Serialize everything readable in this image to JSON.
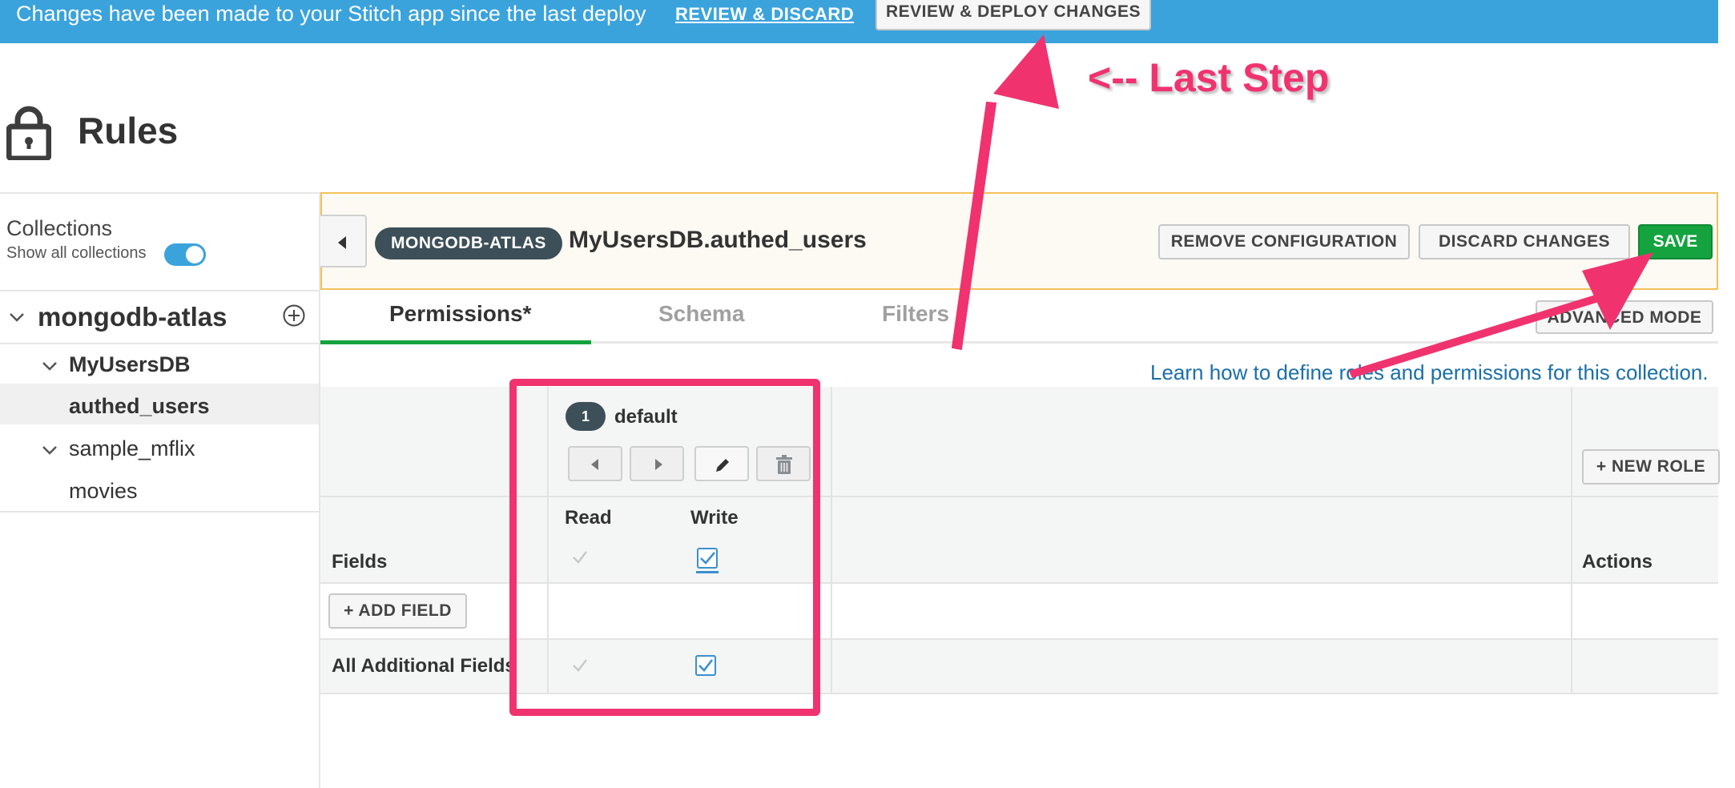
{
  "banner": {
    "message": "Changes have been made to your Stitch app since the last deploy",
    "review_discard_link": "REVIEW & DISCARD",
    "deploy_button": "REVIEW & DEPLOY CHANGES"
  },
  "header": {
    "title": "Rules",
    "icon": "lock-icon"
  },
  "sidebar": {
    "collections_label": "Collections",
    "show_all_label": "Show all collections",
    "show_all_enabled": true,
    "service": {
      "name": "mongodb-atlas",
      "databases": [
        {
          "name": "MyUsersDB",
          "collections": [
            "authed_users"
          ]
        },
        {
          "name": "sample_mflix",
          "collections": [
            "movies"
          ]
        }
      ]
    },
    "selected_collection": "authed_users"
  },
  "collection_header": {
    "service_badge": "MONGODB-ATLAS",
    "namespace": "MyUsersDB.authed_users",
    "remove_button": "REMOVE CONFIGURATION",
    "discard_button": "DISCARD CHANGES",
    "save_button": "SAVE"
  },
  "tabs": [
    {
      "label": "Permissions*",
      "active": true
    },
    {
      "label": "Schema",
      "active": false
    },
    {
      "label": "Filters",
      "active": false
    }
  ],
  "advanced_mode_button": "ADVANCED MODE",
  "learn_link": "Learn how to define roles and permissions for this collection.",
  "permissions": {
    "role": {
      "number": "1",
      "name": "default"
    },
    "read_label": "Read",
    "write_label": "Write",
    "fields_header": "Fields",
    "actions_header": "Actions",
    "add_field_button": "+ ADD FIELD",
    "new_role_button": "+ NEW ROLE",
    "header_read": true,
    "header_write": true,
    "additional_fields_label": "All Additional Fields",
    "additional_read": true,
    "additional_write": true
  },
  "annotation": {
    "text": "<-- Last Step",
    "color": "#f0336f"
  },
  "colors": {
    "banner": "#3ba3dc",
    "save": "#14a33f",
    "badge": "#3d4f58",
    "link": "#1a6fa8",
    "header_border": "#f1c25a"
  }
}
